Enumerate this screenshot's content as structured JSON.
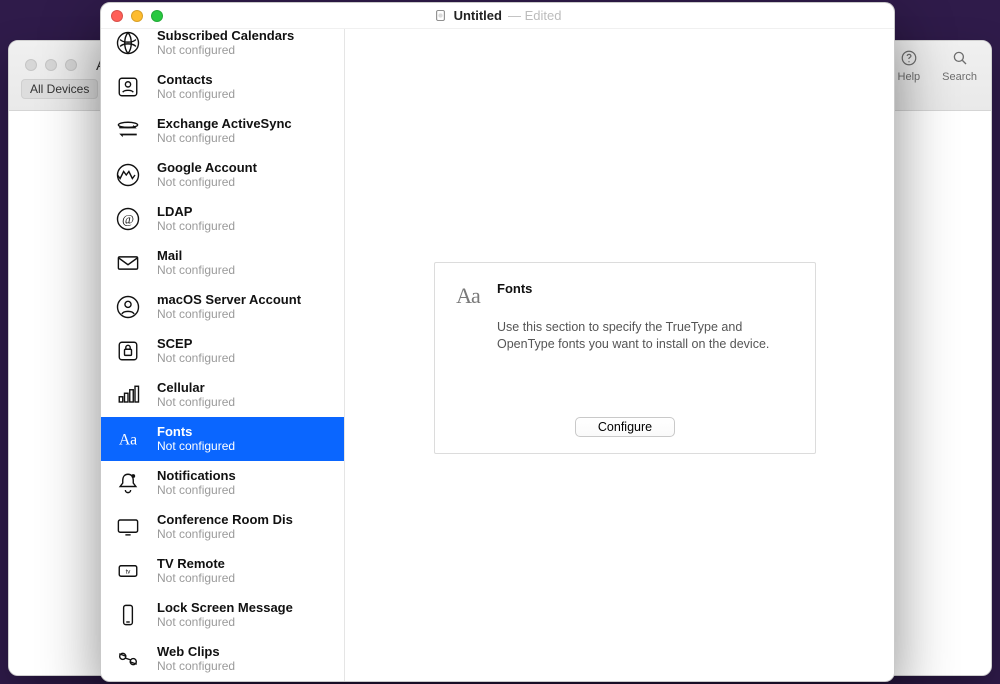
{
  "window": {
    "title_icon": "profile-document-icon",
    "title": "Untitled",
    "status": "— Edited"
  },
  "background_window": {
    "peek_text": "A",
    "chip": "All Devices",
    "right": [
      {
        "icon": "help-icon",
        "label": "Help"
      },
      {
        "icon": "search-icon",
        "label": "Search"
      }
    ]
  },
  "sidebar": {
    "not_configured_label": "Not configured",
    "selected_index": 9,
    "items": [
      {
        "icon": "subscribed-calendars-icon",
        "label": "Subscribed Calendars",
        "status": "Not configured"
      },
      {
        "icon": "contacts-icon",
        "label": "Contacts",
        "status": "Not configured"
      },
      {
        "icon": "exchange-icon",
        "label": "Exchange ActiveSync",
        "status": "Not configured"
      },
      {
        "icon": "google-account-icon",
        "label": "Google Account",
        "status": "Not configured"
      },
      {
        "icon": "ldap-icon",
        "label": "LDAP",
        "status": "Not configured"
      },
      {
        "icon": "mail-icon",
        "label": "Mail",
        "status": "Not configured"
      },
      {
        "icon": "macos-server-account-icon",
        "label": "macOS Server Account",
        "status": "Not configured"
      },
      {
        "icon": "scep-icon",
        "label": "SCEP",
        "status": "Not configured"
      },
      {
        "icon": "cellular-icon",
        "label": "Cellular",
        "status": "Not configured"
      },
      {
        "icon": "fonts-icon",
        "label": "Fonts",
        "status": "Not configured"
      },
      {
        "icon": "notifications-icon",
        "label": "Notifications",
        "status": "Not configured"
      },
      {
        "icon": "conference-room-icon",
        "label": "Conference Room Display",
        "status": "Not configured",
        "display_label": "Conference Room Dis"
      },
      {
        "icon": "tv-remote-icon",
        "label": "TV Remote",
        "status": "Not configured"
      },
      {
        "icon": "lock-screen-message-icon",
        "label": "Lock Screen Message",
        "status": "Not configured"
      },
      {
        "icon": "web-clips-icon",
        "label": "Web Clips",
        "status": "Not configured"
      }
    ]
  },
  "detail": {
    "icon": "fonts-large-icon",
    "title": "Fonts",
    "description": "Use this section to specify the TrueType and OpenType fonts you want to install on the device.",
    "configure_button": "Configure"
  }
}
